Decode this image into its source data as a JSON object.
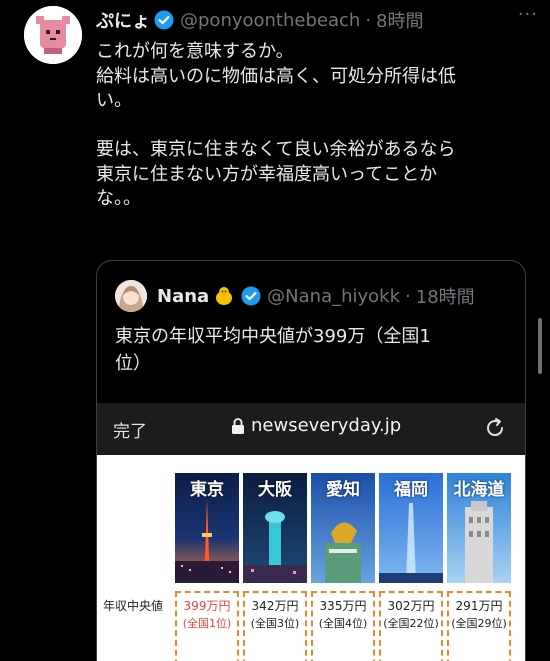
{
  "tweet": {
    "display_name": "ぷにょ",
    "handle": "@ponyoonthebeach",
    "separator": "·",
    "time": "8時間",
    "more": "···",
    "paragraphs": [
      "これが何を意味するか。\n給料は高いのに物価は高く、可処分所得は低\nい。",
      "要は、東京に住まなくて良い余裕があるなら\n東京に住まない方が幸福度高いってことか\nな。。"
    ]
  },
  "quote": {
    "display_name": "Nana",
    "handle": "@Nana_hiyokk",
    "separator": "·",
    "time": "18時間",
    "text": "東京の年収平均中央値が399万（全国1\n位）"
  },
  "browser": {
    "done_label": "完了",
    "url": "newseveryday.jp"
  },
  "article": {
    "row_label": "年収中央値",
    "cities": [
      {
        "name": "東京",
        "value": "399万円",
        "rank": "(全国1位)"
      },
      {
        "name": "大阪",
        "value": "342万円",
        "rank": "(全国3位)"
      },
      {
        "name": "愛知",
        "value": "335万円",
        "rank": "(全国4位)"
      },
      {
        "name": "福岡",
        "value": "302万円",
        "rank": "(全国22位)"
      },
      {
        "name": "北海道",
        "value": "291万円",
        "rank": "(全国29位)"
      }
    ]
  },
  "colors": {
    "accent": "#1d9bf0",
    "highlight": "#e8443a",
    "dashed_box": "#e58a2c"
  }
}
